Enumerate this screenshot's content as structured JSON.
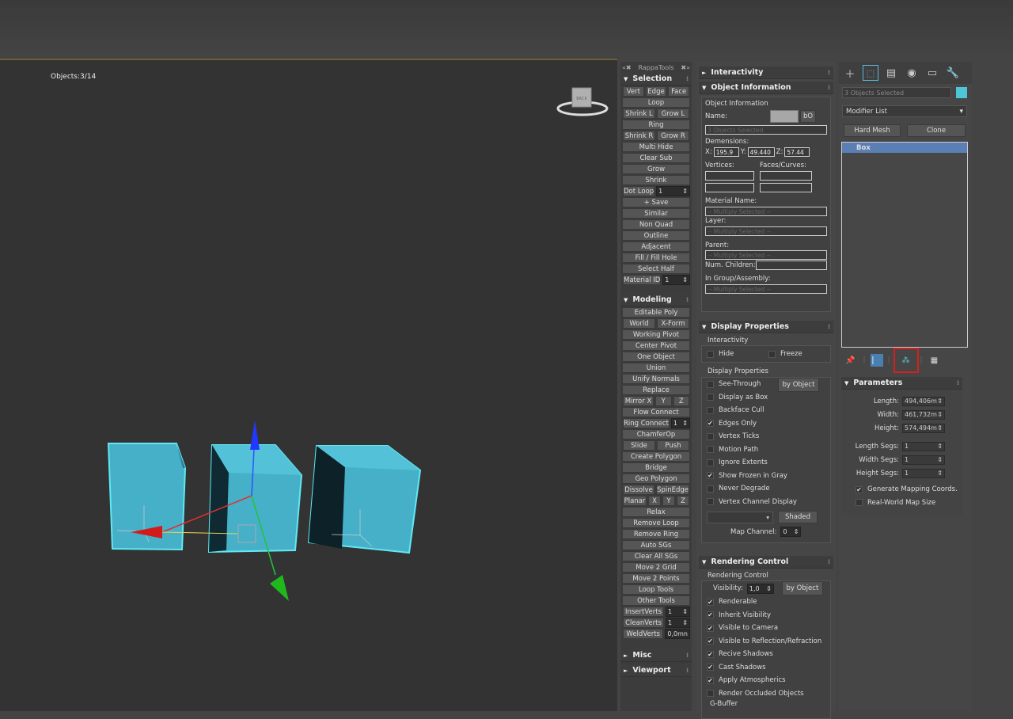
{
  "viewport": {
    "label": "Objects:3/14",
    "viewcube_label": "BACK"
  },
  "rappa": {
    "title": "RappaTools",
    "selection_title": "Selection",
    "modeling_title": "Modeling",
    "misc_title": "Misc",
    "viewport_title": "Viewport",
    "sel": {
      "vert": "Vert",
      "edge": "Edge",
      "face": "Face",
      "loop": "Loop",
      "shrinkl": "Shrink L",
      "growl": "Grow L",
      "ring": "Ring",
      "shrinkr": "Shrink R",
      "growr": "Grow R",
      "multihide": "Multi Hide",
      "clearsub": "Clear Sub",
      "grow": "Grow",
      "shrink": "Shrink",
      "dotloop": "Dot Loop",
      "dotloop_val": "1",
      "save": "+ Save",
      "similar": "Similar",
      "nonquad": "Non Quad",
      "outline": "Outline",
      "adjacent": "Adjacent",
      "fillhole": "Fill / Fill Hole",
      "selecthalf": "Select Half",
      "matid": "Material ID",
      "matid_val": "1"
    },
    "mod": {
      "editpoly": "Editable Poly",
      "world": "World",
      "xform": "X-Form",
      "workpivot": "Working Pivot",
      "centerpivot": "Center Pivot",
      "oneobject": "One Object",
      "union": "Union",
      "unify": "Unify Normals",
      "replace": "Replace",
      "mirrorx": "Mirror X",
      "y": "Y",
      "z": "Z",
      "flow": "Flow Connect",
      "ringconnect": "Ring Connect",
      "ringconnect_val": "1",
      "chamfer": "ChamferOp",
      "slide": "Slide",
      "push": "Push",
      "createpoly": "Create Polygon",
      "bridge": "Bridge",
      "geopoly": "Geo Polygon",
      "dissolve": "Dissolve",
      "spinedge": "SpinEdge",
      "planar": "Planar",
      "px": "X",
      "py": "Y",
      "pz": "Z",
      "relax": "Relax",
      "removeloop": "Remove Loop",
      "removering": "Remove Ring",
      "autosgs": "Auto SGs",
      "clearsgs": "Clear All SGs",
      "move2grid": "Move 2 Grid",
      "move2points": "Move 2 Points",
      "looptools": "Loop Tools",
      "othertools": "Other Tools",
      "insertverts": "InsertVerts",
      "insertverts_val": "1",
      "cleanverts": "CleanVerts",
      "cleanverts_val": "1",
      "weldverts": "WeldVerts",
      "weldverts_val": "0,0mn"
    }
  },
  "mid": {
    "interactivity": "Interactivity",
    "objinfo": "Object Information",
    "objinfo_sub": "Object Information",
    "name_label": "Name:",
    "bo": "bO",
    "name_field": "3 Objects Selected",
    "dimensions": "Demensions:",
    "x_label": "X:",
    "x_val": "195.9",
    "y_label": "Y:",
    "y_val": "49.440",
    "z_label": "Z:",
    "z_val": "57.44",
    "vertices": "Vertices:",
    "faces": "Faces/Curves:",
    "material_name": "Material Name:",
    "multiply": "-- Multiply Selected --",
    "layer": "Layer:",
    "parent": "Parent:",
    "numchildren": "Num. Children:",
    "ingroup": "In Group/Assembly:",
    "displayprops": "Display Properties",
    "interactivity_sub": "Interactivity",
    "hide": "Hide",
    "freeze": "Freeze",
    "displayprops_sub": "Display Properties",
    "seethrough": "See-Through",
    "byobject": "by Object",
    "displayasbox": "Display as Box",
    "backface": "Backface Cull",
    "edgesonly": "Edges Only",
    "vertexticks": "Vertex Ticks",
    "motionpath": "Motion Path",
    "ignoreextents": "Ignore Extents",
    "showfrozen": "Show Frozen in Gray",
    "neverdegrade": "Never Degrade",
    "vertexchannel": "Vertex Channel Display",
    "shaded": "Shaded",
    "mapchannel": "Map Channel:",
    "mapchannel_val": "0",
    "renderingcontrol": "Rendering Control",
    "renderingcontrol_sub": "Rendering Control",
    "visibility": "Visibility:",
    "visibility_val": "1,0",
    "renderable": "Renderable",
    "inheritvis": "Inherit Visibility",
    "visiblecam": "Visible to Camera",
    "visiblerefl": "Visible to Reflection/Refraction",
    "recshadows": "Recive Shadows",
    "castshadows": "Cast Shadows",
    "applyatm": "Apply Atmospherics",
    "renderocc": "Render Occluded Objects",
    "gbuffer": "G-Buffer"
  },
  "right": {
    "selected": "3 Objects Selected",
    "selected_color": "#4fc6d8",
    "modifier_list": "Modifier List",
    "hardmesh": "Hard Mesh",
    "clone": "Clone",
    "stack_item": "Box",
    "parameters": "Parameters",
    "length_label": "Length:",
    "length_val": "494,406m",
    "width_label": "Width:",
    "width_val": "461,732m",
    "height_label": "Height:",
    "height_val": "574,494m",
    "lsegs_label": "Length Segs:",
    "lsegs_val": "1",
    "wsegs_label": "Width Segs:",
    "wsegs_val": "1",
    "hsegs_label": "Height Segs:",
    "hsegs_val": "1",
    "genmap": "Generate Mapping Coords.",
    "realworld": "Real-World Map Size"
  }
}
